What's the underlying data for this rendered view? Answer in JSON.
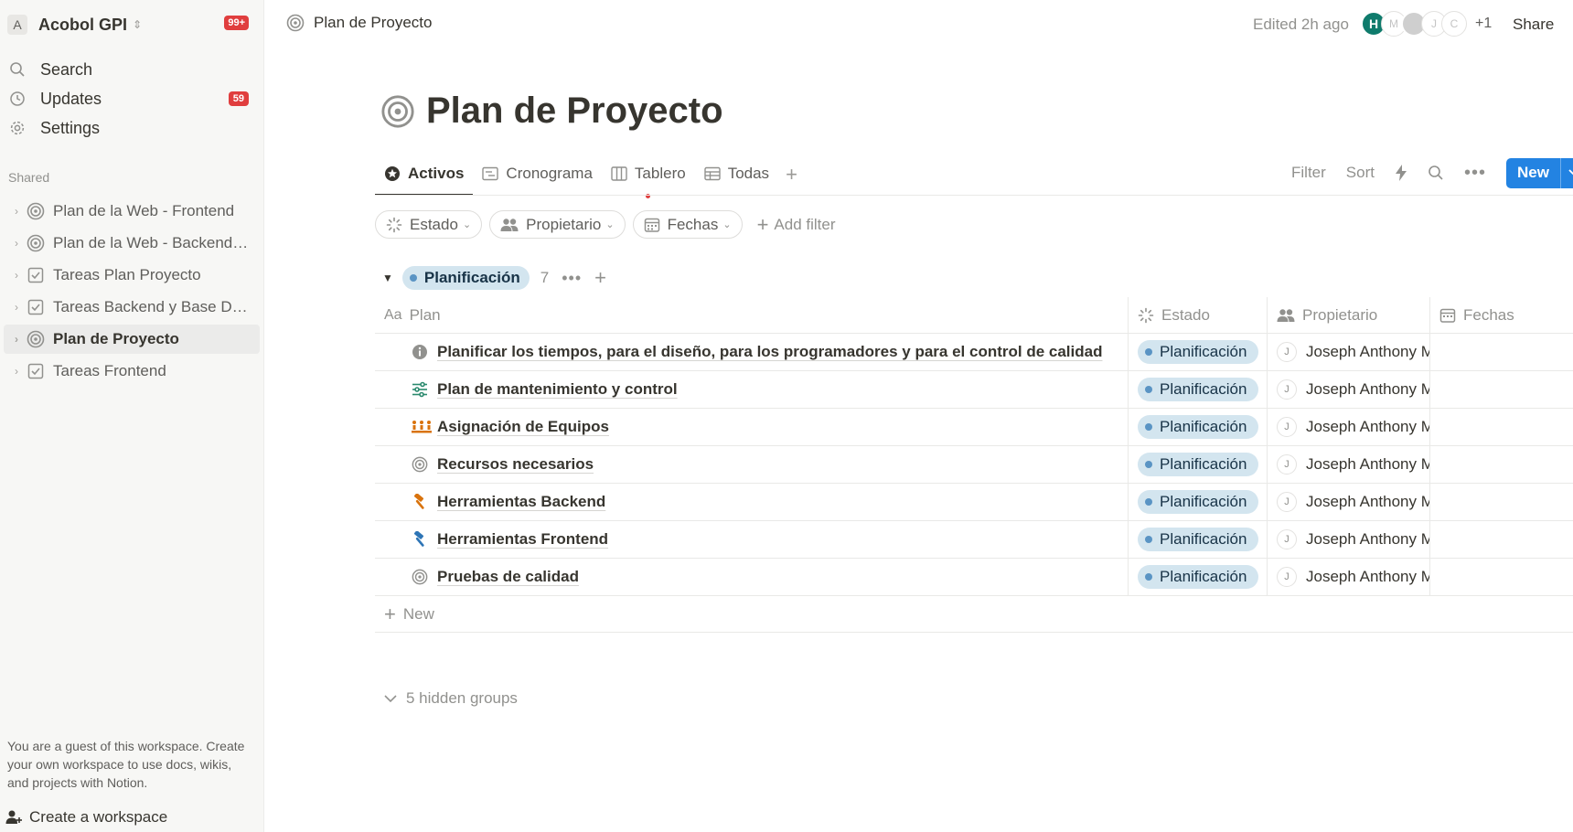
{
  "workspace": {
    "avatar_letter": "A",
    "name": "Acobol GPI",
    "badge": "99+"
  },
  "nav": [
    {
      "label": "Search",
      "icon": "search-icon"
    },
    {
      "label": "Updates",
      "icon": "clock-icon",
      "badge": "59"
    },
    {
      "label": "Settings",
      "icon": "gear-icon"
    }
  ],
  "shared_label": "Shared",
  "tree": [
    {
      "label": "Plan de la Web - Frontend",
      "icon": "target-icon"
    },
    {
      "label": "Plan de la Web - Backend y Base de Datos",
      "icon": "target-icon"
    },
    {
      "label": "Tareas Plan Proyecto",
      "icon": "checkbox-icon"
    },
    {
      "label": "Tareas Backend y Base De Datos",
      "icon": "checkbox-icon"
    },
    {
      "label": "Plan de Proyecto",
      "icon": "target-icon",
      "active": true
    },
    {
      "label": "Tareas Frontend",
      "icon": "checkbox-icon"
    }
  ],
  "guest_note": "You are a guest of this workspace. Create your own workspace to use docs, wikis, and projects with Notion.",
  "create_workspace": "Create a workspace",
  "topbar": {
    "breadcrumb": "Plan de Proyecto",
    "edited": "Edited 2h ago",
    "avatars": [
      "H",
      "M",
      "",
      "J",
      "C"
    ],
    "more_count": "+1",
    "share": "Share"
  },
  "page": {
    "title": "Plan de Proyecto"
  },
  "tabs": [
    {
      "label": "Activos",
      "icon": "star-icon",
      "active": true
    },
    {
      "label": "Cronograma",
      "icon": "timeline-icon"
    },
    {
      "label": "Tablero",
      "icon": "board-icon"
    },
    {
      "label": "Todas",
      "icon": "table-icon"
    }
  ],
  "toolbar": {
    "filter": "Filter",
    "sort": "Sort",
    "new": "New"
  },
  "filters": [
    {
      "label": "Estado",
      "icon": "status-icon"
    },
    {
      "label": "Propietario",
      "icon": "people-icon"
    },
    {
      "label": "Fechas",
      "icon": "calendar-icon"
    }
  ],
  "add_filter": "Add filter",
  "group": {
    "name": "Planificación",
    "count": "7"
  },
  "columns": {
    "plan": "Plan",
    "plan_prefix": "Aa",
    "estado": "Estado",
    "propietario": "Propietario",
    "fechas": "Fechas"
  },
  "rows": [
    {
      "plan": "Planificar los tiempos, para el diseño, para los programadores y para el control de calidad",
      "icon": "info-icon",
      "estado": "Planificación",
      "owner_initial": "J",
      "owner": "Joseph Anthony Machaca"
    },
    {
      "plan": "Plan de mantenimiento y control",
      "icon": "sliders-icon",
      "estado": "Planificación",
      "owner_initial": "J",
      "owner": "Joseph Anthony Machaca"
    },
    {
      "plan": "Asignación de Equipos",
      "icon": "team-icon",
      "estado": "Planificación",
      "owner_initial": "J",
      "owner": "Joseph Anthony Machaca"
    },
    {
      "plan": "Recursos necesarios",
      "icon": "target-icon",
      "estado": "Planificación",
      "owner_initial": "J",
      "owner": "Joseph Anthony Machaca"
    },
    {
      "plan": "Herramientas Backend",
      "icon": "hammer-icon",
      "estado": "Planificación",
      "owner_initial": "J",
      "owner": "Joseph Anthony Machaca"
    },
    {
      "plan": "Herramientas Frontend",
      "icon": "hammer-icon",
      "estado": "Planificación",
      "owner_initial": "J",
      "owner": "Joseph Anthony Machaca"
    },
    {
      "plan": "Pruebas de calidad",
      "icon": "target-icon",
      "estado": "Planificación",
      "owner_initial": "J",
      "owner": "Joseph Anthony Machaca"
    }
  ],
  "new_row": "New",
  "hidden_groups": "5 hidden groups",
  "colors": {
    "accent": "#2383e2",
    "badge": "#e03e3e",
    "pill_bg": "#d3e5ef",
    "pill_dot": "#5a94c4",
    "avatar_h": "#0f7b6c"
  }
}
